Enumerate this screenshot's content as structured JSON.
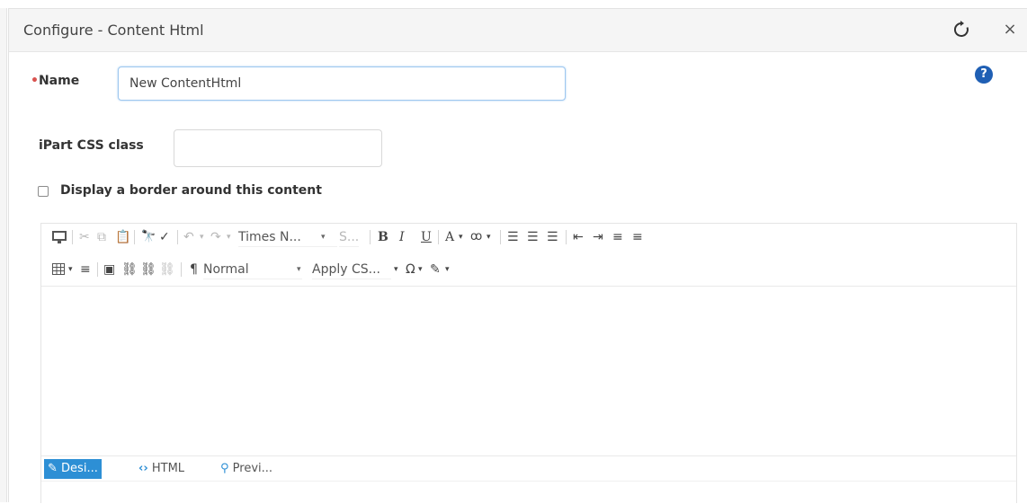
{
  "dialog": {
    "title": "Configure - Content Html",
    "refresh_icon": "refresh-icon",
    "close_label": "×",
    "help_label": "?"
  },
  "form": {
    "name": {
      "required_mark": "•",
      "label": "Name",
      "value": "New ContentHtml"
    },
    "css_class": {
      "label": "iPart CSS class",
      "value": ""
    },
    "border_checkbox": {
      "label": "Display a border around this content",
      "checked": false
    }
  },
  "editor": {
    "font_name": "Times N...",
    "font_size": "S...",
    "format_block": "Normal",
    "apply_css": "Apply CS...",
    "bold": "B",
    "italic": "I",
    "underline": "U",
    "font_color": "A",
    "paragraph_mark": "¶",
    "special_char": "Ω",
    "mode_tabs": [
      {
        "label": "Desi...",
        "icon": "pencil-icon",
        "active": true
      },
      {
        "label": "HTML",
        "icon": "code-icon",
        "active": false
      },
      {
        "label": "Previ...",
        "icon": "magnifier-icon",
        "active": false
      }
    ]
  },
  "colors": {
    "accent": "#2d8fd5",
    "help": "#1f5fb4",
    "required": "#d9534f"
  }
}
